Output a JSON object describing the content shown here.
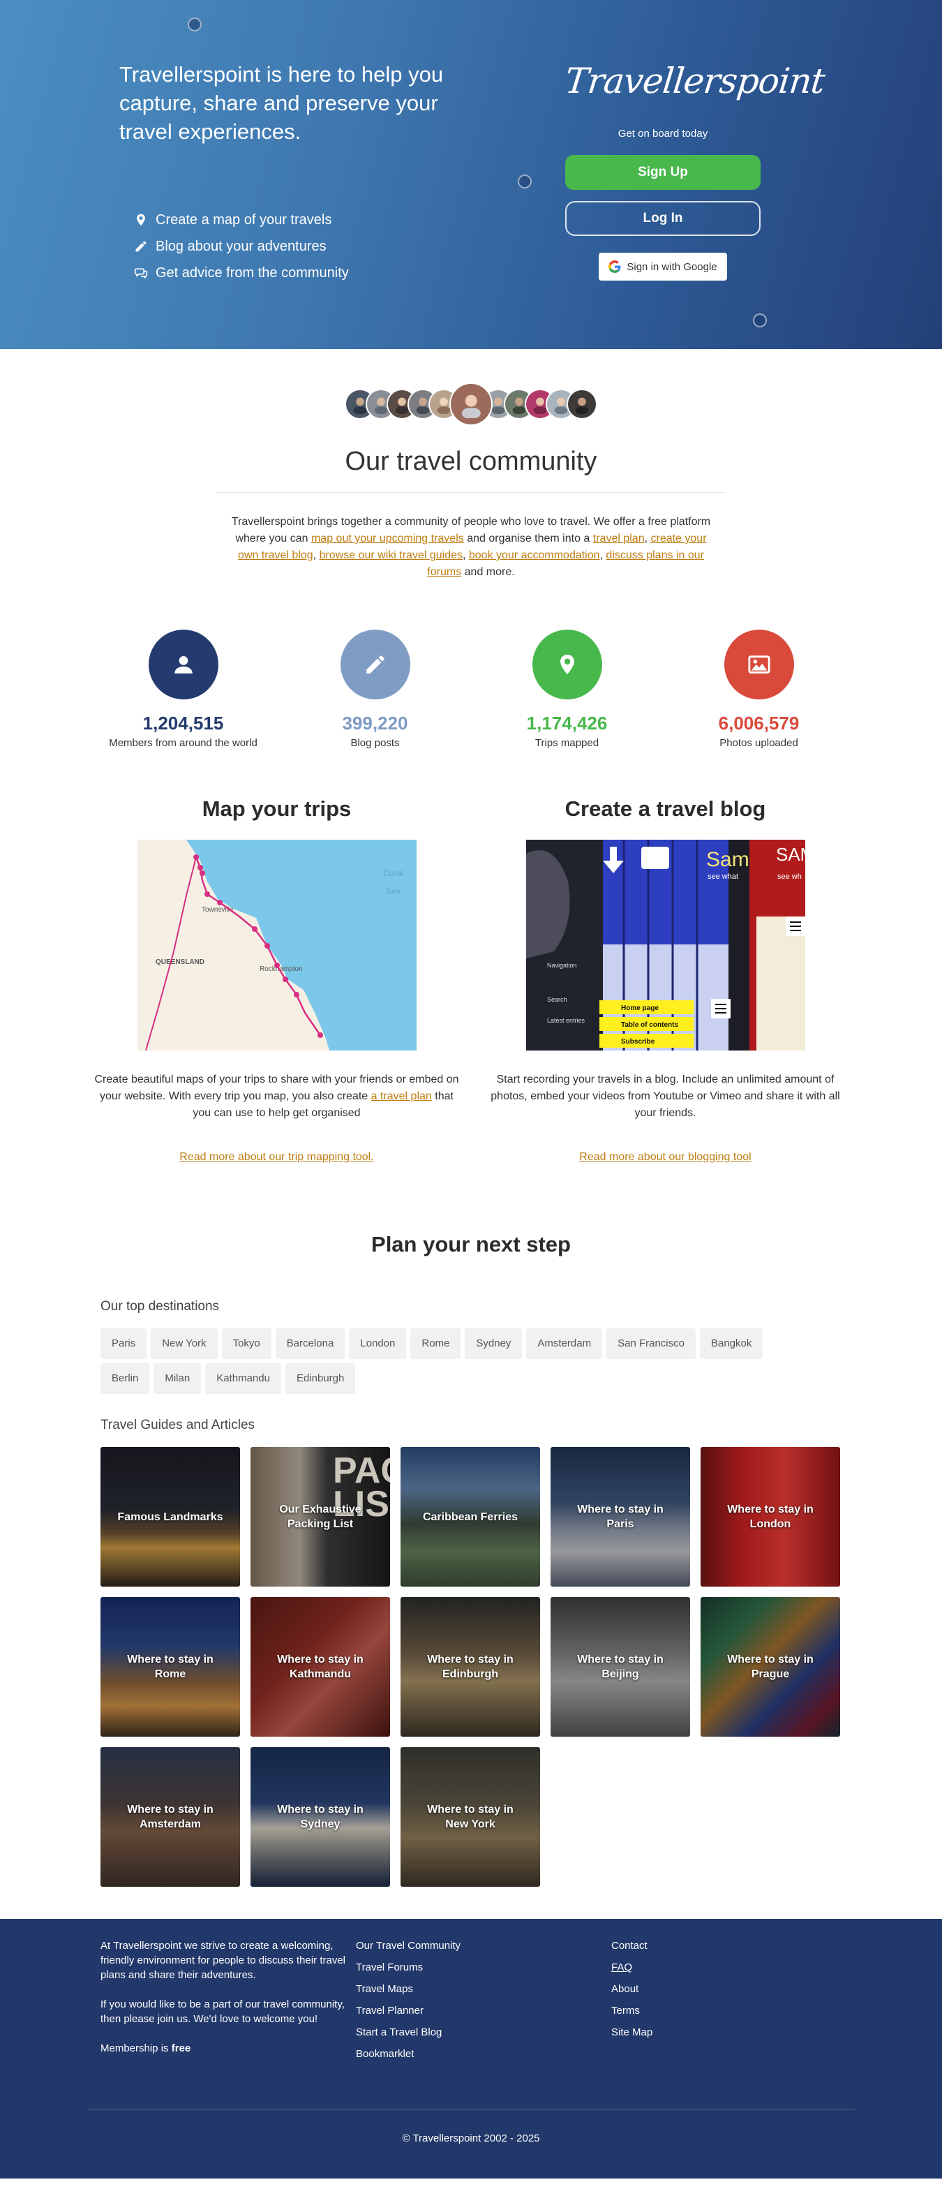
{
  "hero": {
    "headline": "Travellerspoint is here to help you capture, share and preserve your travel experiences.",
    "features": [
      {
        "icon": "map-pin-icon",
        "label": "Create a map of your travels"
      },
      {
        "icon": "pencil-icon",
        "label": "Blog about your adventures"
      },
      {
        "icon": "chat-icon",
        "label": "Get advice from the community"
      }
    ],
    "logo_text": "Travellerspoint",
    "tagline": "Get on board today",
    "signup_label": "Sign Up",
    "login_label": "Log In",
    "google_label": "Sign in with Google"
  },
  "community": {
    "title": "Our travel community",
    "intro": {
      "t1": "Travellerspoint brings together a community of people who love to travel. We offer a free platform where you can ",
      "l1": "map out your upcoming travels",
      "t2": " and organise them into a ",
      "l2": "travel plan",
      "t3": ", ",
      "l3": "create your own travel blog",
      "t4": ", ",
      "l4": "browse our wiki travel guides",
      "t5": ", ",
      "l5": "book your accommodation",
      "t6": ", ",
      "l6": "discuss plans in our forums",
      "t7": " and more."
    },
    "stats": [
      {
        "icon": "user-icon",
        "value": "1,204,515",
        "label": "Members from around the world",
        "color": "#233b6e"
      },
      {
        "icon": "pencil-icon",
        "value": "399,220",
        "label": "Blog posts",
        "color": "#7f9cc4"
      },
      {
        "icon": "map-pin-icon",
        "value": "1,174,426",
        "label": "Trips mapped",
        "color": "#48b84c"
      },
      {
        "icon": "photo-icon",
        "value": "6,006,579",
        "label": "Photos uploaded",
        "color": "#d94a3b"
      }
    ]
  },
  "tools": {
    "map": {
      "title": "Map your trips",
      "map_labels": [
        "Coral",
        "Sea",
        "QUEENSLAND",
        "Townsville",
        "Rockhampton"
      ],
      "desc1": "Create beautiful maps of your trips to share with your friends or embed on your website. With every trip you map, you also create ",
      "desc_link": "a travel plan",
      "desc2": " that you can use to help get organised",
      "more": "Read more about our trip mapping tool."
    },
    "blog": {
      "title": "Create a travel blog",
      "shot_labels": [
        "Sam",
        "see what",
        "SAM",
        "see wh",
        "Navigation",
        "Search",
        "Latest entries",
        "Home page",
        "Table of contents",
        "Subscribe"
      ],
      "desc": "Start recording your travels in a blog. Include an unlimited amount of photos, embed your videos from Youtube or Vimeo and share it with all your friends.",
      "more": "Read more about our blogging tool"
    }
  },
  "plan": {
    "title": "Plan your next step",
    "destinations_heading": "Our top destinations",
    "destinations": [
      "Paris",
      "New York",
      "Tokyo",
      "Barcelona",
      "London",
      "Rome",
      "Sydney",
      "Amsterdam",
      "San Francisco",
      "Bangkok",
      "Berlin",
      "Milan",
      "Kathmandu",
      "Edinburgh"
    ],
    "guides_heading": "Travel Guides and Articles",
    "guides": [
      {
        "title": "Famous Landmarks"
      },
      {
        "title": "Our Exhaustive Packing List"
      },
      {
        "title": "Caribbean Ferries"
      },
      {
        "title": "Where to stay in Paris"
      },
      {
        "title": "Where to stay in London"
      },
      {
        "title": "Where to stay in Rome"
      },
      {
        "title": "Where to stay in Kathmandu"
      },
      {
        "title": "Where to stay in Edinburgh"
      },
      {
        "title": "Where to stay in Beijing"
      },
      {
        "title": "Where to stay in Prague"
      },
      {
        "title": "Where to stay in Amsterdam"
      },
      {
        "title": "Where to stay in Sydney"
      },
      {
        "title": "Where to stay in New York"
      }
    ],
    "packing_image_text": "PACK LIS"
  },
  "footer": {
    "about1": "At Travellerspoint we strive to create a welcoming, friendly environment for people to discuss their travel plans and share their adventures.",
    "about2": "If you would like to be a part of our travel community, then please join us. We'd love to welcome you!",
    "membership_prefix": "Membership is ",
    "membership_free": "free",
    "links_col2": [
      "Our Travel Community",
      "Travel Forums",
      "Travel Maps",
      "Travel Planner",
      "Start a Travel Blog",
      "Bookmarklet"
    ],
    "links_col3": [
      "Contact",
      "FAQ",
      "About",
      "Terms",
      "Site Map"
    ],
    "copyright": "© Travellerspoint 2002 - 2025"
  }
}
